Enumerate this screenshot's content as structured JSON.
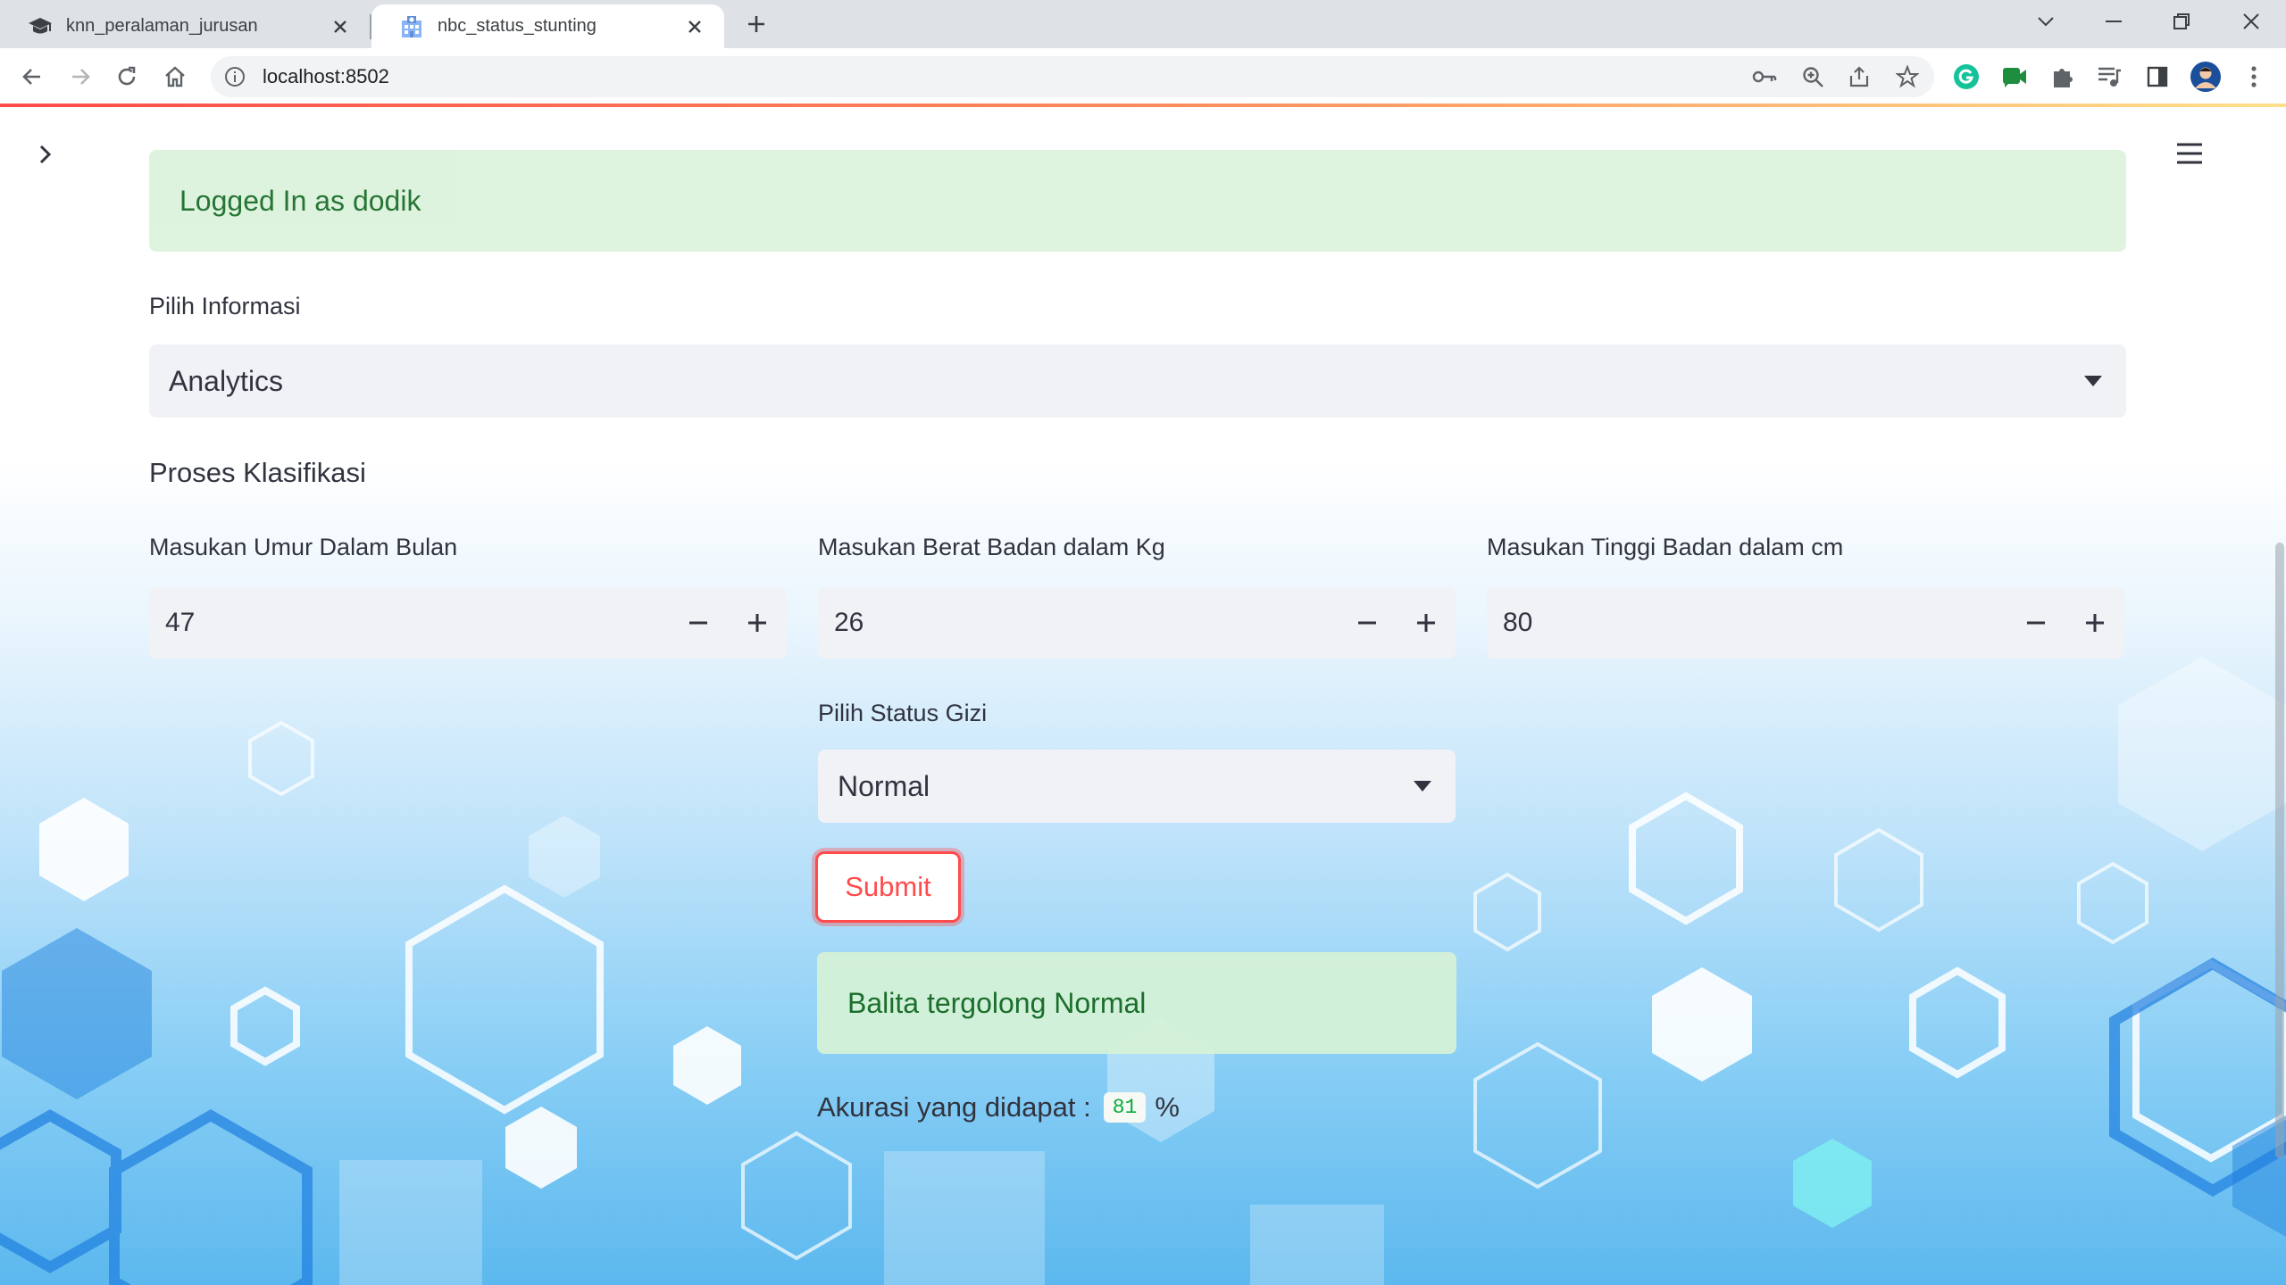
{
  "browser": {
    "tabs": [
      {
        "title": "knn_peralaman_jurusan",
        "icon": "graduation-cap-icon",
        "active": false
      },
      {
        "title": "nbc_status_stunting",
        "icon": "hospital-icon",
        "active": true
      }
    ],
    "url": "localhost:8502",
    "progress_gradient": [
      "#ff4b4b",
      "#ffe08a"
    ]
  },
  "app": {
    "login_message": "Logged In as dodik",
    "pilih_informasi": {
      "label": "Pilih Informasi",
      "selected": "Analytics"
    },
    "section_heading": "Proses Klasifikasi",
    "inputs": {
      "umur": {
        "label": "Masukan Umur Dalam Bulan",
        "value": "47"
      },
      "berat": {
        "label": "Masukan Berat Badan dalam Kg",
        "value": "26"
      },
      "tinggi": {
        "label": "Masukan Tinggi Badan dalam cm",
        "value": "80"
      }
    },
    "status_gizi": {
      "label": "Pilih Status Gizi",
      "selected": "Normal"
    },
    "submit_label": "Submit",
    "result_message": "Balita tergolong Normal",
    "accuracy": {
      "prefix": "Akurasi yang didapat :",
      "value": "81",
      "suffix": "%"
    }
  },
  "colors": {
    "accent": "#ff4b4b",
    "success_bg": "#ddf3dd",
    "success_text": "#1b6e2b",
    "input_bg": "#f0f2f6"
  }
}
